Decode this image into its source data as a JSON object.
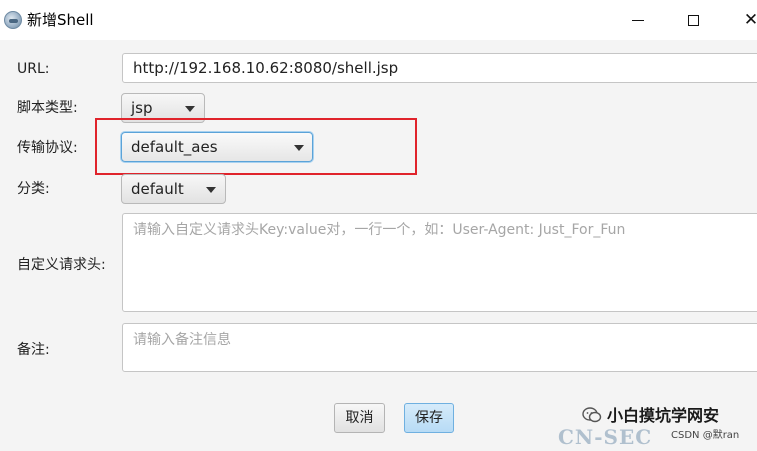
{
  "window": {
    "title": "新增Shell",
    "minimize_glyph": "—",
    "maximize_glyph": "☐",
    "close_glyph": "✕"
  },
  "form": {
    "url_label": "URL:",
    "url_value": "http://192.168.10.62:8080/shell.jsp",
    "script_type_label": "脚本类型:",
    "script_type_value": "jsp",
    "protocol_label": "传输协议:",
    "protocol_value": "default_aes",
    "category_label": "分类:",
    "category_value": "default",
    "headers_label": "自定义请求头:",
    "headers_placeholder": "请输入自定义请求头Key:value对，一行一个，如：User-Agent: Just_For_Fun",
    "notes_label": "备注:",
    "notes_placeholder": "请输入备注信息"
  },
  "buttons": {
    "cancel_label": "取消",
    "save_label": "保存"
  },
  "watermark": {
    "channel_name": "小白摸坑学网安",
    "site_text": "CN-SEC",
    "csdn_text": "CSDN @默ran"
  },
  "colors": {
    "highlight": "#e0232b",
    "focus_border": "#5ba3d8",
    "save_button": "#b7dbf5"
  },
  "icons": {
    "app": "shell-app-icon",
    "dropdown": "chevron-down-icon",
    "watermark": "wechat-channel-icon"
  }
}
